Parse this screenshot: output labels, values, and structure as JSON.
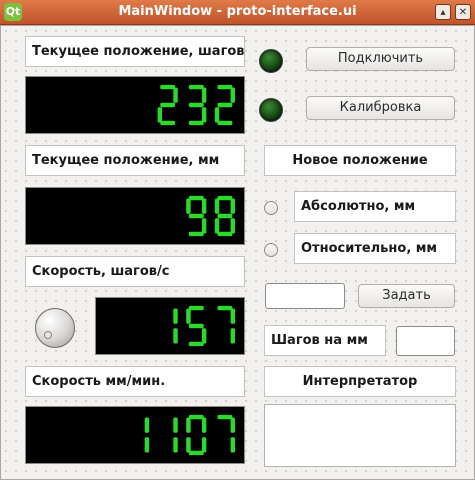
{
  "window": {
    "title": "MainWindow - proto-interface.ui",
    "app_icon_text": "Qt",
    "minimize_glyph": "▴",
    "close_glyph": "✕"
  },
  "left": {
    "position_steps_label": "Текущее положение, шагов",
    "position_steps_value": "232",
    "position_mm_label": "Текущее положение, мм",
    "position_mm_value": "98",
    "speed_steps_label": "Скорость, шагов/с",
    "speed_steps_value": "157",
    "speed_mm_label": "Скорость мм/мин.",
    "speed_mm_value": "1107"
  },
  "right": {
    "connect_button": "Подключить",
    "calibrate_button": "Калибровка",
    "new_position_label": "Новое положение",
    "absolute_label": "Абсолютно, мм",
    "relative_label": "Относительно, мм",
    "position_input_value": "",
    "set_button": "Задать",
    "steps_per_mm_label": "Шагов на мм",
    "steps_per_mm_value": "",
    "interpreter_label": "Интерпретатор",
    "interpreter_text": ""
  },
  "colors": {
    "lcd_background": "#000000",
    "lcd_digit": "#2bd92b",
    "led": "#1f5f1a",
    "title_bar": "#d0623a"
  }
}
